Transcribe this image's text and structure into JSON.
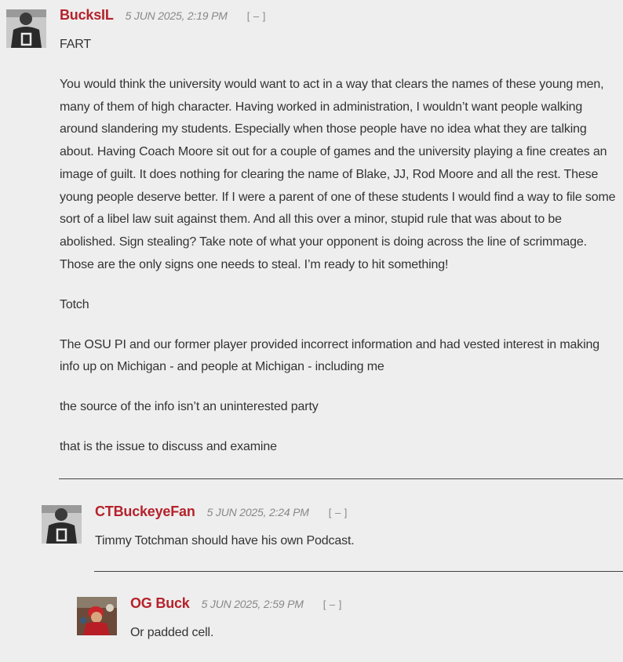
{
  "comments": [
    {
      "author": "BucksIL",
      "date": "5 JUN 2025, 2:19 PM",
      "collapse_label": "[ – ]",
      "paragraphs": [
        "FART",
        "You would think the university would want to act in a way that clears the names of these young men, many of them of high character. Having worked in administration, I wouldn’t want people walking around slandering my students. Especially when those people have no idea what they are talking about. Having Coach Moore sit out for a couple of games and the university playing a fine creates an image of guilt. It does nothing for clearing the name of Blake, JJ, Rod Moore and all the rest. These young people deserve better. If I were a parent of one of these students I would find a way to file some sort of a libel law suit against them. And all this over a minor, stupid rule that was about to be abolished. Sign stealing? Take note of what your opponent is doing across the line of scrimmage. Those are the only signs one needs to steal. I’m ready to hit something!",
        "Totch",
        "The OSU PI and our former player provided incorrect information and had vested interest in making info up on Michigan - and people at Michigan - including me",
        "the source of the info isn’t an uninterested party",
        "that is the issue to discuss and examine"
      ]
    },
    {
      "author": "CTBuckeyeFan",
      "date": "5 JUN 2025, 2:24 PM",
      "collapse_label": "[ – ]",
      "paragraphs": [
        "Timmy Totchman should have his own Podcast."
      ]
    },
    {
      "author": "OG Buck",
      "date": "5 JUN 2025, 2:59 PM",
      "collapse_label": "[ – ]",
      "paragraphs": [
        "Or padded cell."
      ]
    }
  ],
  "colors": {
    "author": "#b5222b",
    "background": "#eeeeee",
    "text": "#333333",
    "meta": "#888888"
  }
}
